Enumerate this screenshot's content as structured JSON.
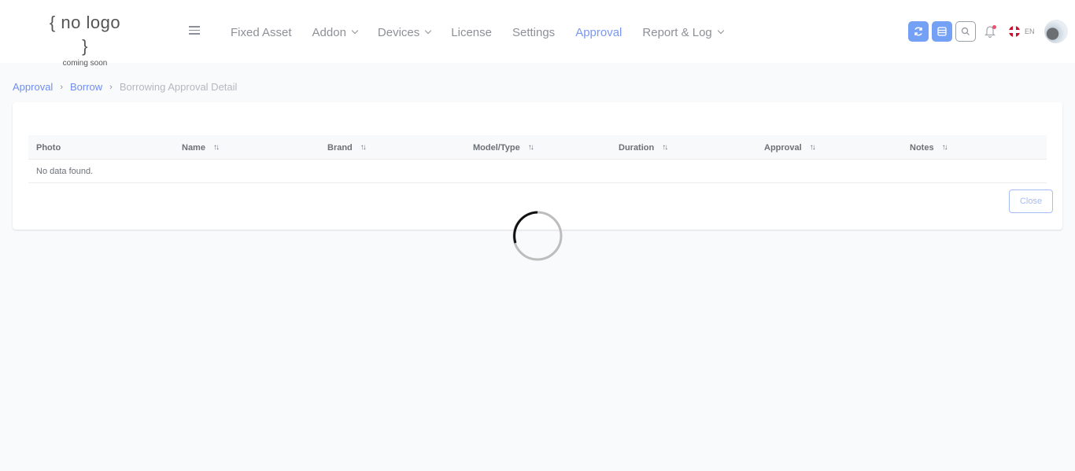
{
  "logo": {
    "main": "{ no logo }",
    "sub": "coming soon"
  },
  "nav": {
    "items": [
      {
        "label": "Fixed Asset",
        "dropdown": false,
        "active": false
      },
      {
        "label": "Addon",
        "dropdown": true,
        "active": false
      },
      {
        "label": "Devices",
        "dropdown": true,
        "active": false
      },
      {
        "label": "License",
        "dropdown": false,
        "active": false
      },
      {
        "label": "Settings",
        "dropdown": false,
        "active": false
      },
      {
        "label": "Approval",
        "dropdown": false,
        "active": true
      },
      {
        "label": "Report & Log",
        "dropdown": true,
        "active": false
      }
    ]
  },
  "header_actions": {
    "refresh_icon": "refresh-icon",
    "list_icon": "list-icon",
    "search_icon": "search-icon",
    "bell_icon": "bell-icon",
    "language": "EN"
  },
  "breadcrumb": {
    "items": [
      "Approval",
      "Borrow",
      "Borrowing Approval Detail"
    ]
  },
  "table": {
    "columns": [
      "Photo",
      "Name",
      "Brand",
      "Model/Type",
      "Duration",
      "Approval",
      "Notes"
    ],
    "empty_message": "No data found."
  },
  "close_label": "Close",
  "colors": {
    "accent": "#74a0f6",
    "active_nav": "#7a97f5",
    "background": "#f9fafc",
    "notification": "#f0506e"
  }
}
